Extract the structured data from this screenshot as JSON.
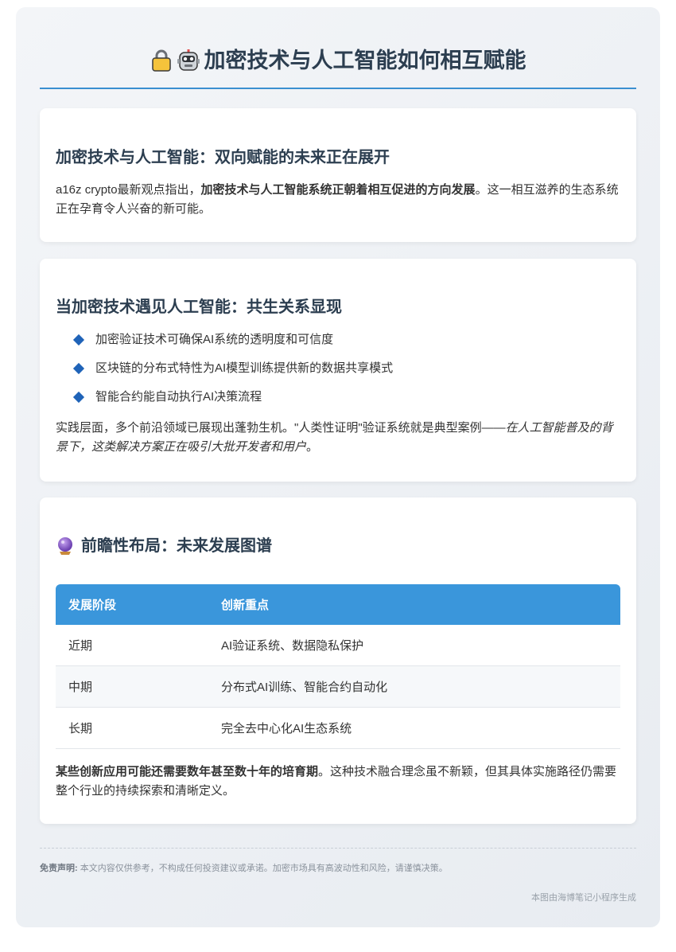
{
  "header": {
    "title": "加密技术与人工智能如何相互赋能"
  },
  "section1": {
    "heading": "加密技术与人工智能：双向赋能的未来正在展开",
    "para_start": "a16z crypto最新观点指出，",
    "para_bold": "加密技术与人工智能系统正朝着相互促进的方向发展",
    "para_end": "。这一相互滋养的生态系统正在孕育令人兴奋的新可能。"
  },
  "section2": {
    "heading": "当加密技术遇见人工智能：共生关系显现",
    "bullets": [
      "加密验证技术可确保AI系统的透明度和可信度",
      "区块链的分布式特性为AI模型训练提供新的数据共享模式",
      "智能合约能自动执行AI决策流程"
    ],
    "para_start": "实践层面，多个前沿领域已展现出蓬勃生机。\"人类性证明\"验证系统就是典型案例——",
    "para_italic": "在人工智能普及的背景下，这类解决方案正在吸引大批开发者和用户",
    "para_end": "。"
  },
  "section3": {
    "heading": "前瞻性布局：未来发展图谱",
    "table": {
      "headers": [
        "发展阶段",
        "创新重点"
      ],
      "rows": [
        [
          "近期",
          "AI验证系统、数据隐私保护"
        ],
        [
          "中期",
          "分布式AI训练、智能合约自动化"
        ],
        [
          "长期",
          "完全去中心化AI生态系统"
        ]
      ]
    },
    "para_bold": "某些创新应用可能还需要数年甚至数十年的培育期",
    "para_end": "。这种技术融合理念虽不新颖，但其具体实施路径仍需要整个行业的持续探索和清晰定义。"
  },
  "footer": {
    "disclaimer_label": "免责声明:",
    "disclaimer_text": " 本文内容仅供参考，不构成任何投资建议或承诺。加密市场具有高波动性和风险，请谨慎决策。",
    "credit": "本图由海博笔记小程序生成"
  },
  "colors": {
    "accent": "#3a96db",
    "heading": "#2c3e50",
    "bullet": "#1f63b8"
  },
  "icons": {
    "title_icons": [
      "lock-icon",
      "robot-icon"
    ],
    "section3_icon": "crystal-ball-icon"
  }
}
